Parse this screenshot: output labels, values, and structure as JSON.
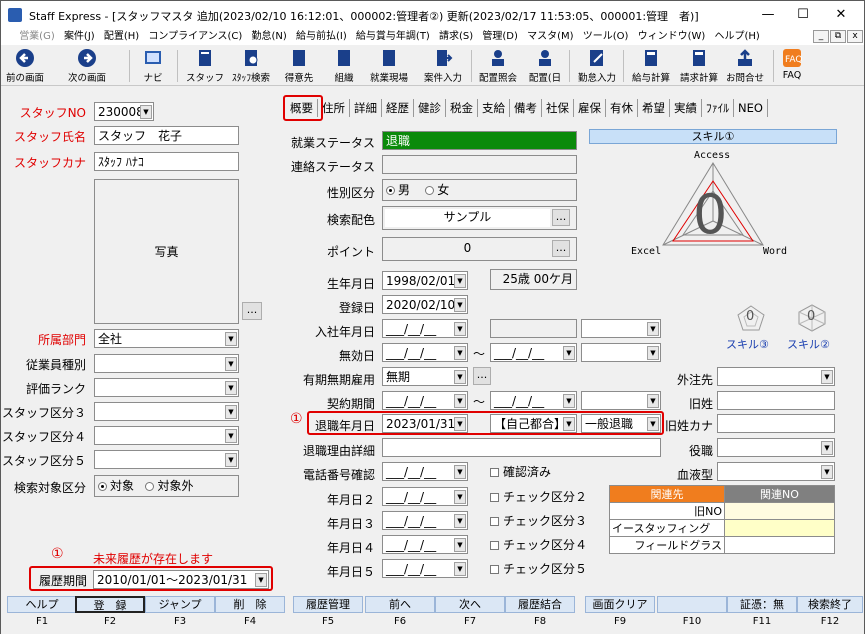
{
  "window": {
    "title": "Staff Express - [スタッフマスタ 追加(2023/02/10 16:12:01、000002:管理者②) 更新(2023/02/17 11:53:05、000001:管理　者)]",
    "minimize": "—",
    "maximize": "☐",
    "close": "✕"
  },
  "menu": [
    "営業(G)",
    "案件(J)",
    "配置(H)",
    "コンプライアンス(C)",
    "勤怠(N)",
    "給与前払(I)",
    "給与賞与年調(T)",
    "請求(S)",
    "管理(D)",
    "マスタ(M)",
    "ツール(O)",
    "ウィンドウ(W)",
    "ヘルプ(H)"
  ],
  "mdi": {
    "min": "_",
    "restore": "⧉",
    "close": "x"
  },
  "toolbar": [
    "前の画面",
    "次の画面",
    "ナビ",
    "スタッフ",
    "ｽﾀｯﾌ検索",
    "得意先",
    "組織",
    "就業現場",
    "案件入力",
    "配置照会",
    "配置(日",
    "勤怠入力",
    "給与計算",
    "請求計算",
    "お問合せ",
    "FAQ"
  ],
  "left": {
    "staff_no_label": "スタッフNO",
    "staff_no": "230008",
    "name_label": "スタッフ氏名",
    "name": "スタッフ　花子",
    "kana_label": "スタッフカナ",
    "kana": "ｽﾀｯﾌ ﾊﾅｺ",
    "photo_label": "写真",
    "photo_btn": "...",
    "dept_label": "所属部門",
    "dept": "全社",
    "emp_type_label": "従業員種別",
    "rank_label": "評価ランク",
    "kubun3_label": "スタッフ区分３",
    "kubun4_label": "スタッフ区分４",
    "kubun5_label": "スタッフ区分５",
    "search_label": "検索対象区分",
    "search_on": "対象",
    "search_off": "対象外",
    "marker": "①",
    "future_note": "未来履歴が存在します",
    "history_label": "履歴期間",
    "history": "2010/01/01～2023/01/31"
  },
  "tabs": [
    "概要",
    "住所",
    "詳細",
    "経歴",
    "健診",
    "税金",
    "支給",
    "備考",
    "社保",
    "雇保",
    "有休",
    "希望",
    "実績",
    "ﾌｧｲﾙ",
    "NEO"
  ],
  "form": {
    "work_status_label": "就業ステータス",
    "work_status": "退職",
    "contact_status_label": "連絡ステータス",
    "gender_label": "性別区分",
    "male": "男",
    "female": "女",
    "color_label": "検索配色",
    "color_sample": "サンプル",
    "point_label": "ポイント",
    "point": "0",
    "birth_label": "生年月日",
    "birth": "1998/02/01",
    "age": "25歳 00ケ月",
    "reg_label": "登録日",
    "reg": "2020/02/10",
    "hire_label": "入社年月日",
    "date_blank": "___/__/__",
    "invalid_label": "無効日",
    "tilde": "～",
    "term_label": "有期無期雇用",
    "term": "無期",
    "contract_label": "契約期間",
    "retire_label": "退職年月日",
    "retire": "2023/01/31",
    "retire_reason": "【自己都合】",
    "retire_type": "一般退職",
    "retire_detail_label": "退職理由詳細",
    "phone_label": "電話番号確認",
    "confirmed": "確認済み",
    "d2_label": "年月日２",
    "d3_label": "年月日３",
    "d4_label": "年月日４",
    "d5_label": "年月日５",
    "c2": "チェック区分２",
    "c3": "チェック区分３",
    "c4": "チェック区分４",
    "c5": "チェック区分５",
    "outsource_label": "外注先",
    "old_name_label": "旧姓",
    "old_kana_label": "旧姓カナ",
    "role_label": "役職",
    "blood_label": "血液型"
  },
  "skill": {
    "title": "スキル①",
    "access": "Access",
    "excel": "Excel",
    "word": "Word",
    "value": "0",
    "skill3": "スキル③",
    "skill2": "スキル②",
    "mini": "0"
  },
  "relation": {
    "col1": "関連先",
    "col2": "関連NO",
    "rows": [
      "旧NO",
      "イースタッフィング",
      "フィールドグラス"
    ]
  },
  "fkeys": [
    [
      "ヘルプ",
      "F1"
    ],
    [
      "登　録",
      "F2"
    ],
    [
      "ジャンプ",
      "F3"
    ],
    [
      "削　除",
      "F4"
    ],
    [
      "履歴管理",
      "F5"
    ],
    [
      "前へ",
      "F6"
    ],
    [
      "次へ",
      "F7"
    ],
    [
      "履歴結合",
      "F8"
    ],
    [
      "画面クリア",
      "F9"
    ],
    [
      "",
      "F10"
    ],
    [
      "証憑：無",
      "F11"
    ],
    [
      "検索終了",
      "F12"
    ]
  ],
  "colors": {
    "status_green": "#0a8a0a",
    "accent_red": "#e00000",
    "fkey_bg": "#dbe7f5",
    "relation_header": "#f07d1e",
    "skill_header": "#c8e0f8"
  }
}
